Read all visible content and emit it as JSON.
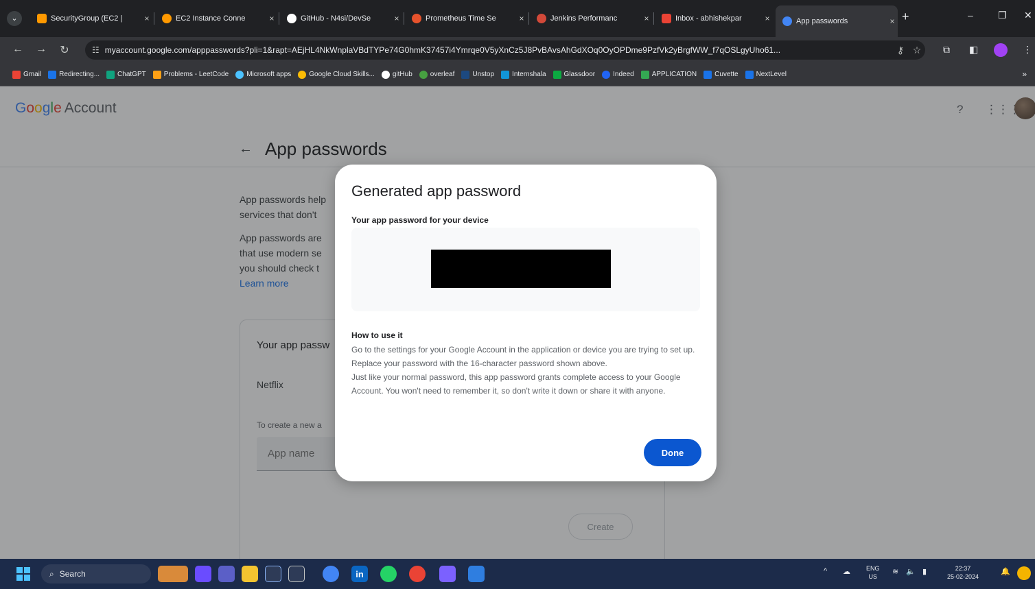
{
  "browser": {
    "tabs": [
      {
        "title": "SecurityGroup (EC2 |",
        "color": "#ff9900"
      },
      {
        "title": "EC2 Instance Conne",
        "color": "#ff9900"
      },
      {
        "title": "GitHub - N4si/DevSe",
        "color": "#ffffff"
      },
      {
        "title": "Prometheus Time Se",
        "color": "#e6522c"
      },
      {
        "title": "Jenkins Performanc",
        "color": "#d24939"
      },
      {
        "title": "Inbox - abhishekpar",
        "color": "#ea4335"
      },
      {
        "title": "App passwords",
        "color": "#4285f4"
      }
    ],
    "close_glyph": "×",
    "new_tab": "+",
    "url": "myaccount.google.com/apppasswords?pli=1&rapt=AEjHL4NkWnplaVBdTYPe74G0hmK37457i4Ymrqe0V5yXnCz5J8PvBAvsAhGdXOq0OyOPDme9PzfVk2yBrgfWW_f7qOSLgyUho61...",
    "bookmarks": [
      {
        "label": "Gmail",
        "color": "#ea4335"
      },
      {
        "label": "Redirecting...",
        "color": "#1a73e8"
      },
      {
        "label": "ChatGPT",
        "color": "#10a37f"
      },
      {
        "label": "Problems - LeetCode",
        "color": "#ffa116"
      },
      {
        "label": "Microsoft apps",
        "color": "#4cc2ff"
      },
      {
        "label": "Google Cloud Skills...",
        "color": "#fbbc05"
      },
      {
        "label": "gitHub",
        "color": "#ffffff"
      },
      {
        "label": "overleaf",
        "color": "#47a141"
      },
      {
        "label": "Unstop",
        "color": "#1c4980"
      },
      {
        "label": "Internshala",
        "color": "#1295d8"
      },
      {
        "label": "Glassdoor",
        "color": "#0caa41"
      },
      {
        "label": "Indeed",
        "color": "#2164f3"
      },
      {
        "label": "APPLICATION",
        "color": "#34a853"
      },
      {
        "label": "Cuvette",
        "color": "#1a73e8"
      },
      {
        "label": "NextLevel",
        "color": "#1a73e8"
      }
    ],
    "more": "»"
  },
  "page": {
    "logo": {
      "g": "G",
      "o1": "o",
      "o2": "o",
      "g2": "g",
      "l": "l",
      "e": "e",
      "account": "Account"
    },
    "title": "App passwords",
    "intro": {
      "p1_line1": "App passwords help",
      "p1_line2": "services that don't",
      "p2_line1": "App passwords are",
      "p2_line2": "that use modern se",
      "p2_line3": "you should check t",
      "learn_more": "Learn more"
    },
    "card": {
      "title": "Your app passw",
      "app_entry": "Netflix",
      "hint": "To create a new a",
      "input_placeholder": "App name",
      "create_label": "Create"
    }
  },
  "dialog": {
    "title": "Generated app password",
    "subtitle": "Your app password for your device",
    "howto_title": "How to use it",
    "howto_p1": "Go to the settings for your Google Account in the application or device you are trying to set up. Replace your password with the 16-character password shown above.",
    "howto_p2": "Just like your normal password, this app password grants complete access to your Google Account. You won't need to remember it, so don't write it down or share it with anyone.",
    "done_label": "Done"
  },
  "taskbar": {
    "search_label": "Search",
    "lang_top": "ENG",
    "lang_bottom": "US",
    "time": "22:37",
    "date": "25-02-2024"
  }
}
